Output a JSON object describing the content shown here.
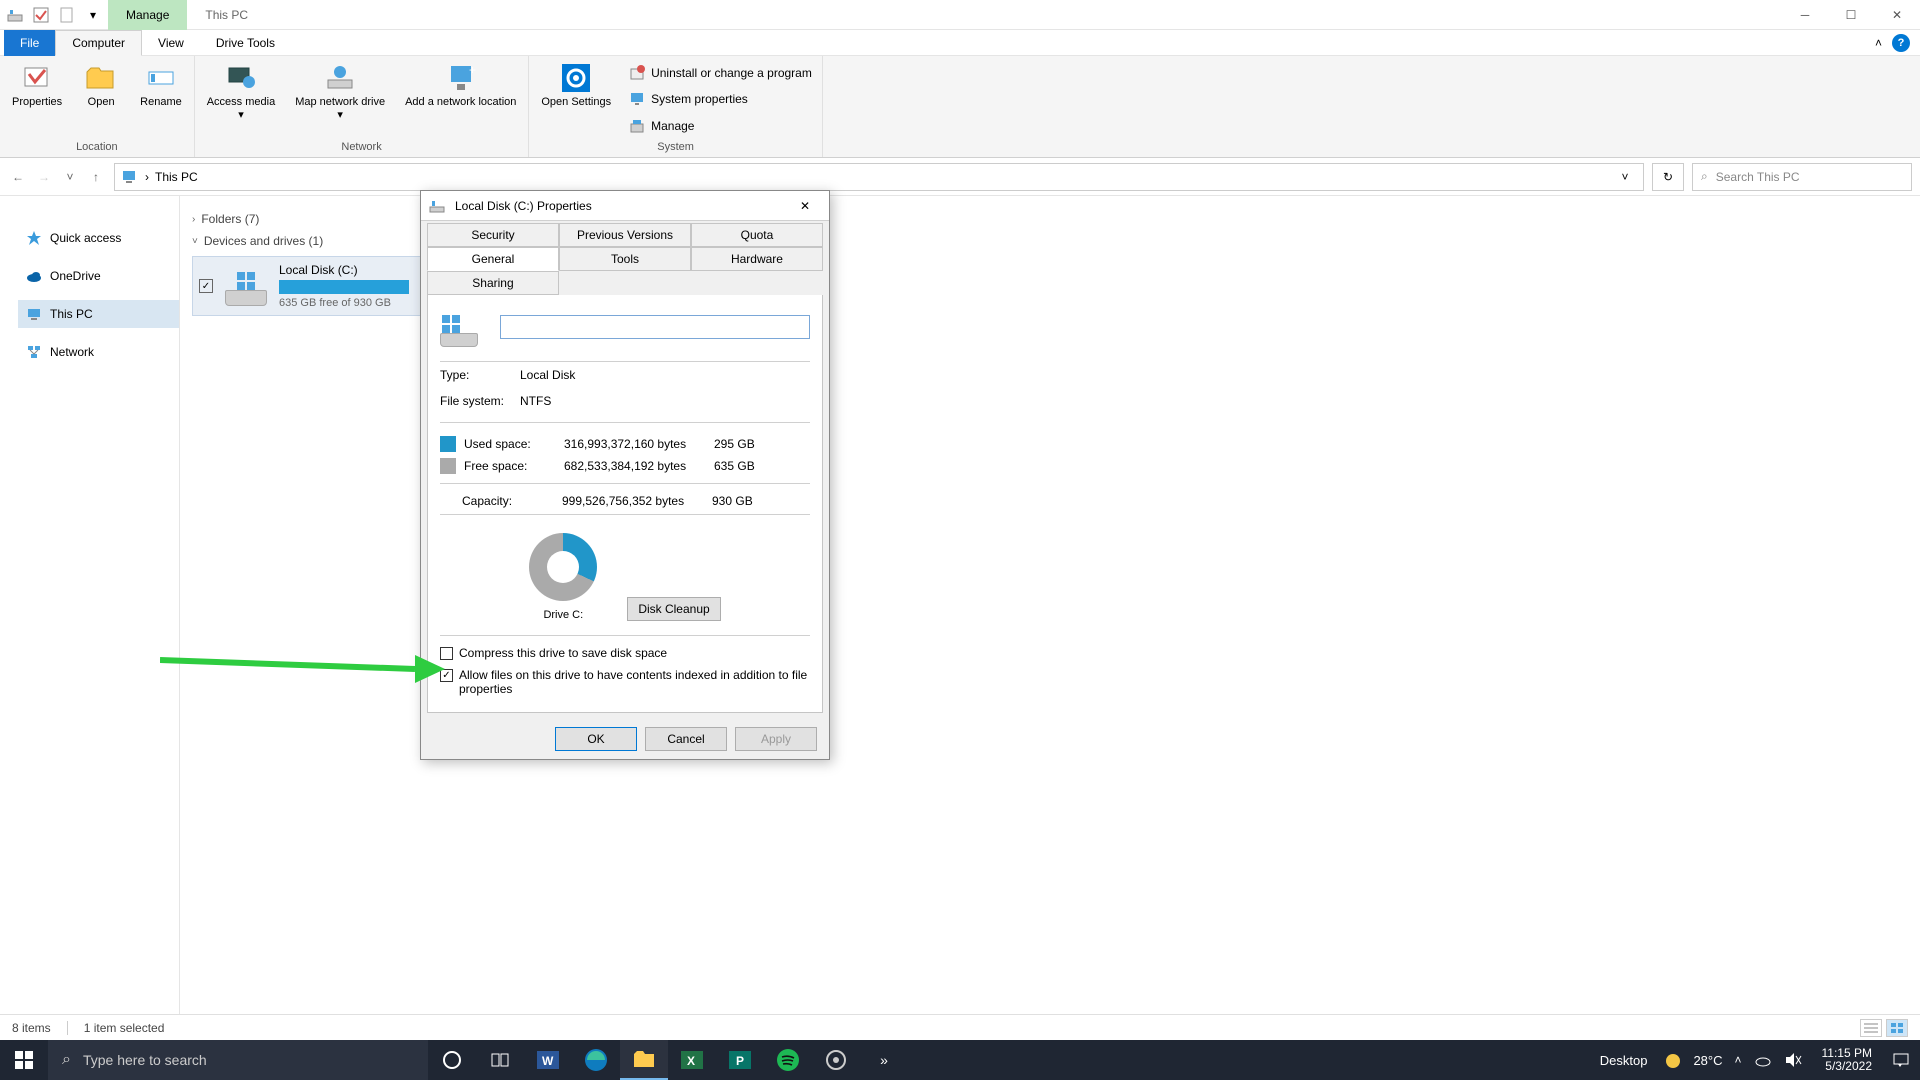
{
  "titlebar": {
    "manage_tab": "Manage",
    "title": "This PC"
  },
  "ribbon_tabs": {
    "file": "File",
    "computer": "Computer",
    "view": "View",
    "drive_tools": "Drive Tools"
  },
  "ribbon": {
    "location": {
      "label": "Location",
      "properties": "Properties",
      "open": "Open",
      "rename": "Rename"
    },
    "network": {
      "label": "Network",
      "access_media": "Access media",
      "map_drive": "Map network drive",
      "add_loc": "Add a network location"
    },
    "system": {
      "label": "System",
      "open_settings": "Open Settings",
      "uninstall": "Uninstall or change a program",
      "sys_props": "System properties",
      "manage": "Manage"
    }
  },
  "address": {
    "path": "This PC",
    "search_placeholder": "Search This PC"
  },
  "nav": {
    "quick_access": "Quick access",
    "onedrive": "OneDrive",
    "this_pc": "This PC",
    "network": "Network"
  },
  "content": {
    "folders_header": "Folders (7)",
    "drives_header": "Devices and drives (1)",
    "drive": {
      "name": "Local Disk (C:)",
      "free_text": "635 GB free of 930 GB"
    }
  },
  "dialog": {
    "title": "Local Disk (C:) Properties",
    "tabs": {
      "security": "Security",
      "previous": "Previous Versions",
      "quota": "Quota",
      "general": "General",
      "tools": "Tools",
      "hardware": "Hardware",
      "sharing": "Sharing"
    },
    "name_value": "",
    "type_label": "Type:",
    "type_value": "Local Disk",
    "fs_label": "File system:",
    "fs_value": "NTFS",
    "used_label": "Used space:",
    "used_bytes": "316,993,372,160 bytes",
    "used_gb": "295 GB",
    "free_label": "Free space:",
    "free_bytes": "682,533,384,192 bytes",
    "free_gb": "635 GB",
    "cap_label": "Capacity:",
    "cap_bytes": "999,526,756,352 bytes",
    "cap_gb": "930 GB",
    "drive_letter": "Drive C:",
    "disk_cleanup": "Disk Cleanup",
    "compress_label": "Compress this drive to save disk space",
    "index_label": "Allow files on this drive to have contents indexed in addition to file properties",
    "ok": "OK",
    "cancel": "Cancel",
    "apply": "Apply"
  },
  "status": {
    "items": "8 items",
    "selected": "1 item selected"
  },
  "taskbar": {
    "search_placeholder": "Type here to search",
    "desktop": "Desktop",
    "temp": "28°C",
    "time": "11:15 PM",
    "date": "5/3/2022"
  }
}
